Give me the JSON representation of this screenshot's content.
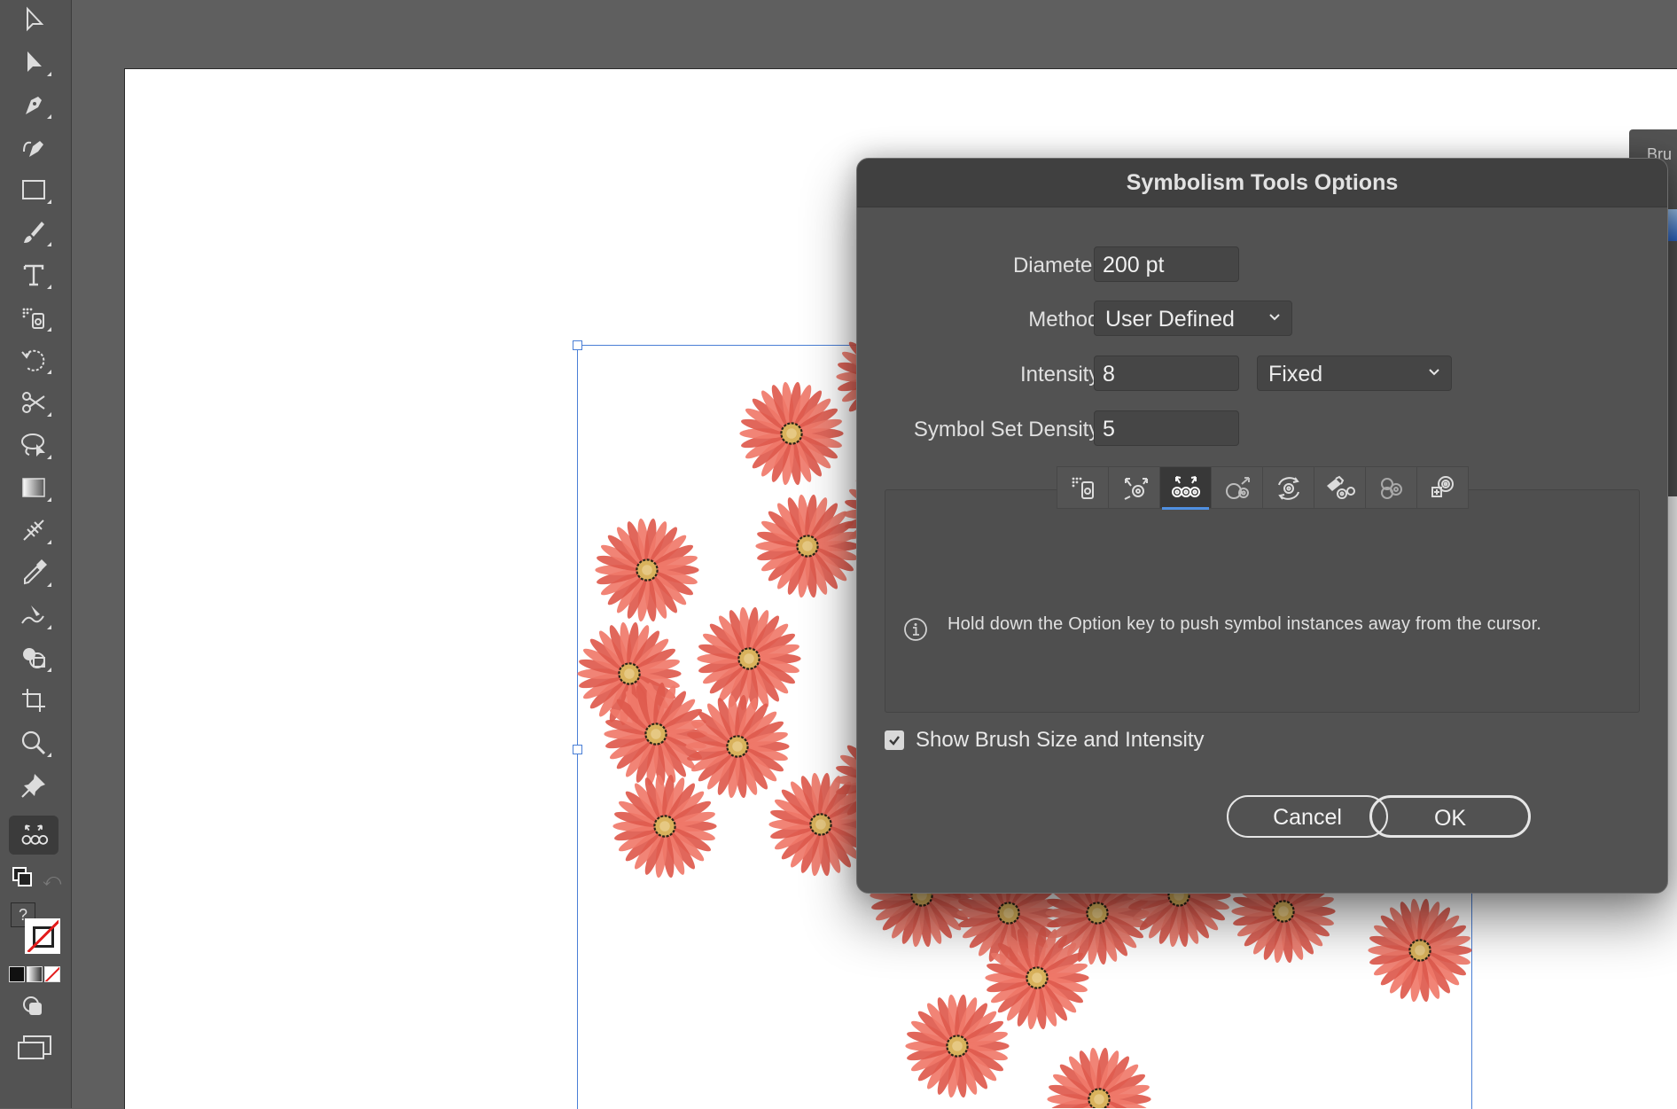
{
  "dialog": {
    "title": "Symbolism Tools Options",
    "diameter_label": "Diameter:",
    "diameter_value": "200 pt",
    "method_label": "Method:",
    "method_value": "User Defined",
    "intensity_label": "Intensity:",
    "intensity_value": "8",
    "intensity_mode": "Fixed",
    "density_label": "Symbol Set Density:",
    "density_value": "5",
    "tool_tabs": [
      {
        "name": "symbol-sprayer",
        "icon": "sprayer-icon"
      },
      {
        "name": "symbol-shifter",
        "icon": "shifter-icon"
      },
      {
        "name": "symbol-scruncher",
        "icon": "scruncher-icon",
        "selected": true
      },
      {
        "name": "symbol-sizer",
        "icon": "sizer-icon"
      },
      {
        "name": "symbol-spinner",
        "icon": "spinner-icon"
      },
      {
        "name": "symbol-stainer",
        "icon": "stainer-icon"
      },
      {
        "name": "symbol-screener",
        "icon": "screener-icon"
      },
      {
        "name": "symbol-styler",
        "icon": "styler-icon"
      }
    ],
    "hint": "Hold down the Option key to push symbol instances away from the cursor.",
    "checkbox_label": "Show Brush Size and Intensity",
    "checkbox_checked": true,
    "cancel_label": "Cancel",
    "ok_label": "OK"
  },
  "right_panel": {
    "label": "Bru"
  },
  "toolbar": {
    "tools": [
      "selection-tool",
      "direct-selection-tool",
      "pen-tool",
      "curvature-tool",
      "rectangle-tool",
      "paintbrush-tool",
      "type-tool",
      "symbol-sprayer-tool",
      "rotate-tool",
      "scissors-tool",
      "lasso-tool",
      "gradient-tool",
      "mesh-tool",
      "eyedropper-tool",
      "warp-tool",
      "shape-builder-tool",
      "artboard-tool",
      "zoom-tool",
      "puppet-warp-tool",
      "symbol-scruncher-tool"
    ],
    "active_tool": "symbol-scruncher-tool"
  },
  "colors": {
    "petal": "#f07a6a",
    "petal_dark": "#de5a4d",
    "center": "#d9b25c",
    "selection": "#4a7fd6"
  }
}
